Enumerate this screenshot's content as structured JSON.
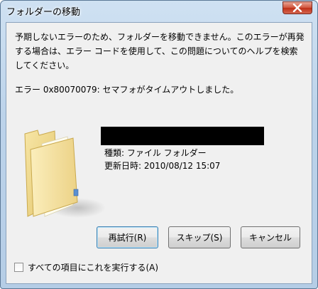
{
  "window": {
    "title": "フォルダーの移動"
  },
  "message": "予期しないエラーのため、フォルダーを移動できません。このエラーが再発する場合は、エラー コードを使用して、この問題についてのヘルプを検索してください。",
  "error_line": "エラー 0x80070079: セマフォがタイムアウトしました。",
  "item": {
    "type_line": "種類: ファイル フォルダー",
    "date_line": "更新日時: 2010/08/12 15:07"
  },
  "buttons": {
    "retry": "再試行(R)",
    "skip": "スキップ(S)",
    "cancel": "キャンセル"
  },
  "checkbox": {
    "label": "すべての項目にこれを実行する(A)",
    "checked": false
  },
  "icons": {
    "close": "close-icon",
    "folder": "folder-icon"
  },
  "colors": {
    "close_button": "#c9452c",
    "dialog_bg": "#f0f0f0",
    "frame": "#b9d1ea"
  }
}
